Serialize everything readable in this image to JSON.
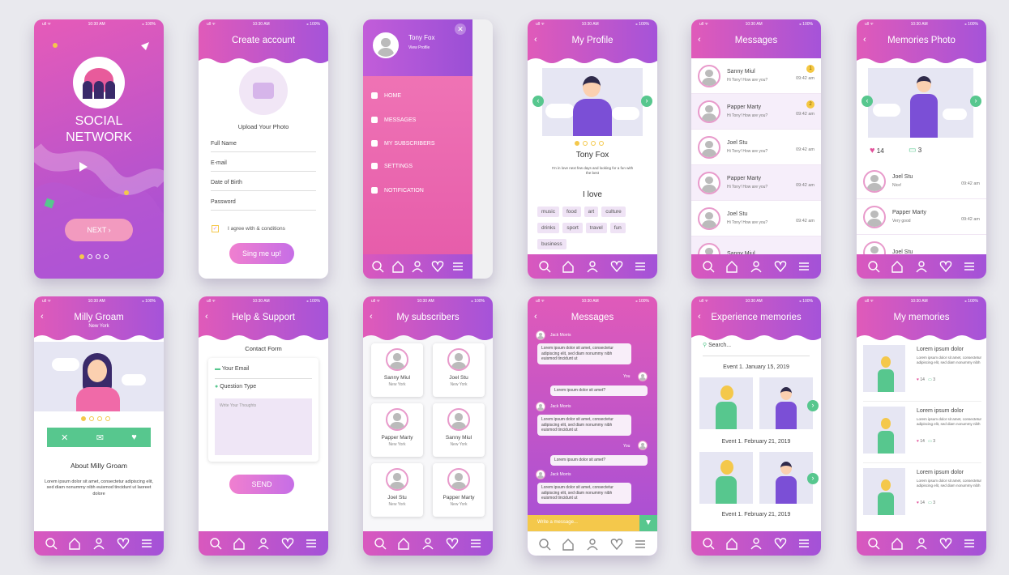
{
  "status": {
    "signal": "ull ᯤ",
    "time": "10:30 AM",
    "battery": "⁎ 100%"
  },
  "colors": {
    "pink": "#e35db8",
    "purple": "#a54fd6",
    "yellow": "#f4c84b",
    "green": "#57c78e"
  },
  "splash": {
    "title1": "SOCIAL",
    "title2": "NETWORK",
    "next": "NEXT ›"
  },
  "create": {
    "title": "Create account",
    "upload": "Upload Your Photo",
    "full_name": "Full Name",
    "email": "E-mail",
    "dob": "Date of Birth",
    "password": "Password",
    "agree": "I agree with & conditions",
    "signup": "Sing me up!"
  },
  "menu": {
    "name": "Tony Fox",
    "view": "View Profile",
    "items": [
      "HOME",
      "MESSAGES",
      "MY SUBSCRIBERS",
      "SETTINGS",
      "NOTIFICATION"
    ]
  },
  "profile": {
    "title": "My Profile",
    "name": "Tony Fox",
    "bio": "I'm in love next few days and looking for a fun with the best",
    "love": "I love",
    "tags": [
      "music",
      "food",
      "art",
      "culture",
      "drinks",
      "sport",
      "travel",
      "fun",
      "business"
    ]
  },
  "messages": {
    "title": "Messages",
    "rows": [
      {
        "name": "Sanny Miul",
        "preview": "Hi Tony! How are you?",
        "time": "09:42 am",
        "badge": "1"
      },
      {
        "name": "Papper Marty",
        "preview": "Hi Tony! How are you?",
        "time": "09:42 am",
        "badge": "2"
      },
      {
        "name": "Joel Stu",
        "preview": "Hi Tony! How are you?",
        "time": "09:42 am",
        "badge": ""
      },
      {
        "name": "Papper Marty",
        "preview": "Hi Tony! How are you?",
        "time": "09:42 am",
        "badge": ""
      },
      {
        "name": "Joel Stu",
        "preview": "Hi Tony! How are you?",
        "time": "09:42 am",
        "badge": ""
      },
      {
        "name": "Sanny Miul",
        "preview": "",
        "time": "",
        "badge": ""
      }
    ]
  },
  "memphoto": {
    "title": "Memories Photo",
    "likes": "14",
    "comments": "3",
    "rows": [
      {
        "name": "Joel Stu",
        "text": "Nice!",
        "time": "09:42 am"
      },
      {
        "name": "Papper Marty",
        "text": "Very good",
        "time": "09:42 am"
      },
      {
        "name": "Joel Stu",
        "text": "",
        "time": ""
      }
    ]
  },
  "milly": {
    "title": "Milly Groam",
    "location": "New York",
    "about": "About Milly Groam",
    "text": "Lorem ipsum dolor sit amet, consectetur adipiscing elit, sed diam nonummy nibh euismod tincidunt ut laoreet dolore"
  },
  "help": {
    "title": "Help & Support",
    "form": "Contact Form",
    "email": "Your Email",
    "question": "Question Type",
    "placeholder": "Write Your Thoughts",
    "send": "SEND"
  },
  "subs": {
    "title": "My subscribers",
    "cards": [
      {
        "name": "Sanny Miul",
        "loc": "New York"
      },
      {
        "name": "Joel Stu",
        "loc": "New York"
      },
      {
        "name": "Papper Marty",
        "loc": "New York"
      },
      {
        "name": "Sanny Miul",
        "loc": "New York"
      },
      {
        "name": "Joel Stu",
        "loc": "New York"
      },
      {
        "name": "Papper Marty",
        "loc": "New York"
      }
    ]
  },
  "chat": {
    "title": "Messages",
    "from": "Jack Morris",
    "long": "Lorem ipsum dolor sit amet, consectetur adipiscing elit, sed diam nonummy nibh euismod tincidunt ut",
    "you": "You",
    "reply": "Lorem ipsum dolor sit amet?",
    "input": "Write a message..."
  },
  "experience": {
    "title": "Experience memories",
    "search": "Search...",
    "events": [
      "Event 1. January 15, 2019",
      "Event 1. February 21, 2019",
      "Event 1. February 21, 2019"
    ]
  },
  "mymem": {
    "title": "My memories",
    "item_title": "Lorem ipsum dolor",
    "item_text": "Lorem ipsum dolor sit amet, consectetur adipiscing elit, sed diam nonummy nibh",
    "likes": "14",
    "comments": "3"
  }
}
